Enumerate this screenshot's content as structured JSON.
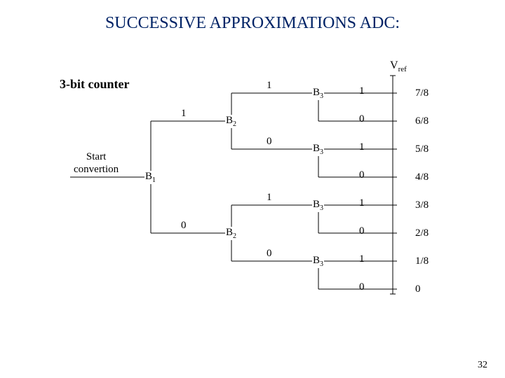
{
  "title": "SUCCESSIVE APPROXIMATIONS ADC:",
  "vref_sym": "V",
  "vref_sub": "ref",
  "subtitle": "3-bit counter",
  "start_l1": "Start",
  "start_l2": "convertion",
  "B": "B",
  "sub1": "1",
  "sub2": "2",
  "sub3": "3",
  "edge": {
    "one": "1",
    "zero": "0"
  },
  "frac": [
    "7/8",
    "6/8",
    "5/8",
    "4/8",
    "3/8",
    "2/8",
    "1/8",
    "0"
  ],
  "out": [
    "1",
    "0",
    "1",
    "0",
    "1",
    "0",
    "1",
    "0"
  ],
  "page": "32",
  "chart_data": {
    "type": "table",
    "title": "SAR ADC 3-bit decision tree, outputs as fraction of Vref",
    "categories": [
      "7/8",
      "6/8",
      "5/8",
      "4/8",
      "3/8",
      "2/8",
      "1/8",
      "0"
    ]
  }
}
